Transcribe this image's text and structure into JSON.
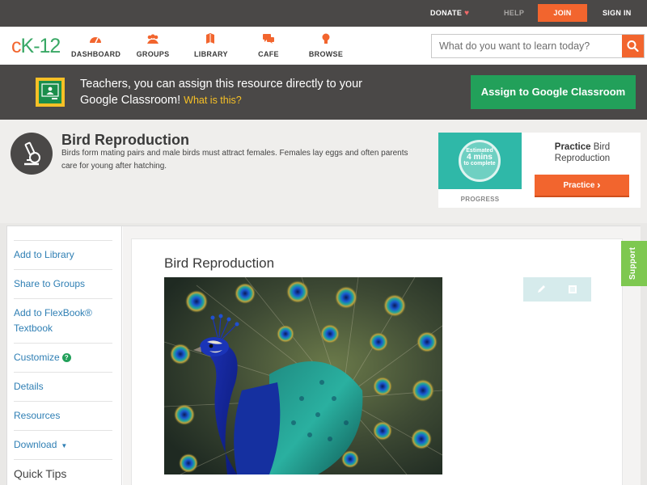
{
  "topbar": {
    "donate": "DONATE",
    "help": "HELP",
    "join": "JOIN",
    "signin": "SIGN IN"
  },
  "nav": {
    "logo": "cK-12",
    "items": [
      {
        "label": "DASHBOARD",
        "icon": "dashboard-icon"
      },
      {
        "label": "GROUPS",
        "icon": "groups-icon"
      },
      {
        "label": "LIBRARY",
        "icon": "library-icon"
      },
      {
        "label": "CAFE",
        "icon": "cafe-icon"
      },
      {
        "label": "BROWSE",
        "icon": "browse-icon"
      }
    ],
    "search_placeholder": "What do you want to learn today?"
  },
  "banner": {
    "message": "Teachers, you can assign this resource directly to your Google Classroom!",
    "what_link": "What is this?",
    "assign_button": "Assign to Google Classroom"
  },
  "concept": {
    "title": "Bird Reproduction",
    "description": "Birds form mating pairs and male birds must attract females. Females lay eggs and often parents care for young after hatching."
  },
  "practice": {
    "estimate_top": "Estimated",
    "estimate_value": "4 mins",
    "estimate_bottom": "to complete",
    "progress_label": "PROGRESS",
    "title_bold": "Practice",
    "title_rest": "Bird Reproduction",
    "button": "Practice"
  },
  "sidebar": {
    "items": [
      {
        "label": "Add to Library"
      },
      {
        "label": "Share to Groups"
      },
      {
        "label": "Add to FlexBook® Textbook"
      },
      {
        "label": "Customize"
      },
      {
        "label": "Details"
      },
      {
        "label": "Resources"
      },
      {
        "label": "Download"
      }
    ],
    "quick_tips": "Quick Tips"
  },
  "content": {
    "title": "Bird Reproduction"
  },
  "support": "Support",
  "colors": {
    "brand_orange": "#f2652e",
    "brand_green": "#22a05a",
    "dark_bar": "#4a4847",
    "link_blue": "#2f7fb4"
  }
}
